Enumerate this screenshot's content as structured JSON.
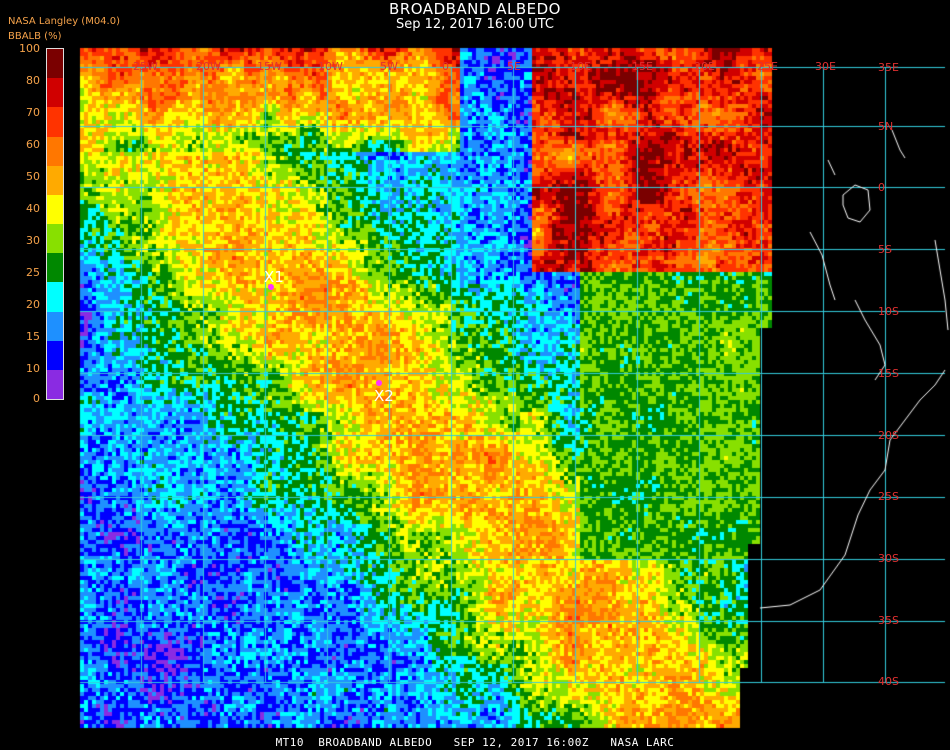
{
  "header": {
    "title": "BROADBAND ALBEDO",
    "subtitle": "Sep 12, 2017 16:00 UTC",
    "producer": "NASA Langley (M04.0)",
    "colorbar_title": "BBALB (%)"
  },
  "colorbar": {
    "labels": [
      "100",
      "80",
      "70",
      "60",
      "50",
      "40",
      "30",
      "25",
      "20",
      "15",
      "10",
      "0"
    ],
    "colors": [
      "#7a0000",
      "#d00000",
      "#ff3300",
      "#ff7700",
      "#ffaa00",
      "#ffff00",
      "#88e000",
      "#008800",
      "#00ffff",
      "#1e90ff",
      "#0000ff",
      "#8a2be2"
    ]
  },
  "map": {
    "lat_labels": [
      "35E",
      "5N",
      "0",
      "5S",
      "10S",
      "15S",
      "20S",
      "25S",
      "30S",
      "35S",
      "40S"
    ],
    "lon_labels": [
      "25W",
      "20W",
      "15W",
      "10W",
      "5W",
      "0",
      "5E",
      "10E",
      "15E",
      "20E",
      "25E",
      "30E"
    ],
    "markers": [
      {
        "label": "X1"
      },
      {
        "label": "X2"
      }
    ],
    "grid_color": "#33ccdd",
    "coast_color": "#ffffff"
  },
  "footer": {
    "text": "MT10  BROADBAND ALBEDO   SEP 12, 2017 16:00Z   NASA LARC"
  }
}
